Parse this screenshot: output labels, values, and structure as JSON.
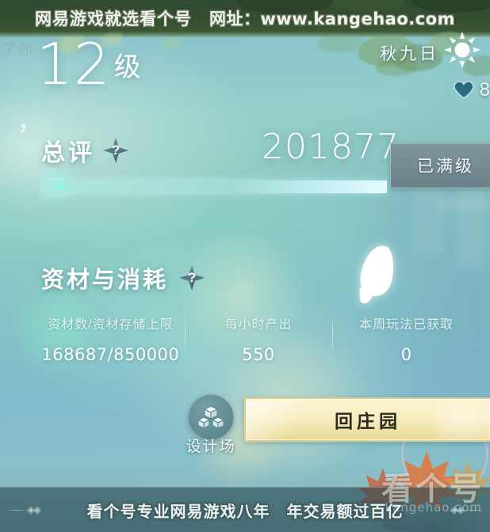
{
  "watermark": {
    "top_left_text": "网易游戏就选看个号",
    "top_right_text": "网址：www.kangehao.com",
    "bottom_text": "看个号专业网易游戏八年　年交易额过百亿",
    "bottom_left_diamond": "◈◈",
    "bottom_right_diamond": "◈◈",
    "logo_text": "看个号",
    "logo_sub": "kangehao.com"
  },
  "ghost": {
    "residual_dialogue": "了你",
    "residual_comma": "，"
  },
  "hud": {
    "season_day": "秋九日",
    "sun_icon": "sun-icon",
    "heart_icon": "heart-icon",
    "heart_count": "8"
  },
  "level": {
    "number": "12",
    "unit": "级"
  },
  "rating": {
    "title": "总评",
    "help_icon": "?",
    "value": "201877",
    "max_badge": "已满级",
    "progress_percent": 100
  },
  "resources": {
    "title": "资材与消耗",
    "help_icon": "?",
    "columns": [
      {
        "label": "资材数/资材存储上限",
        "value": "168687/850000"
      },
      {
        "label": "每小时产出",
        "value": "550"
      },
      {
        "label": "本周玩法已获取",
        "value": "0"
      }
    ]
  },
  "actions": {
    "design_label": "设计场",
    "design_icon": "cubes-icon",
    "manor_label": "回庄园"
  },
  "colors": {
    "sky": "#8cc6cc",
    "accent_gold": "#f7eec0",
    "badge_gray": "#7d9298",
    "text_white": "#ffffff",
    "watermark_outline": "#5a6a52"
  }
}
